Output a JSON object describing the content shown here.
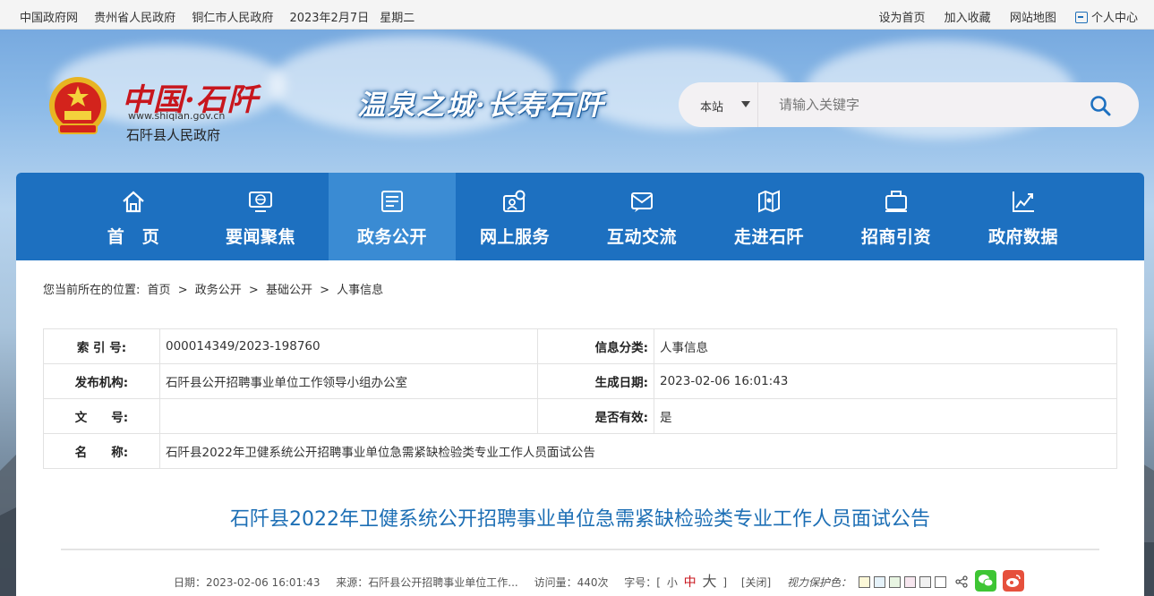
{
  "topbar": {
    "left": [
      "中国政府网",
      "贵州省人民政府",
      "铜仁市人民政府",
      "2023年2月7日",
      "星期二"
    ],
    "right": {
      "home": "设为首页",
      "favorite": "加入收藏",
      "sitemap": "网站地图",
      "personal": "个人中心"
    }
  },
  "header": {
    "logo_text": "中国·石阡",
    "logo_url": "www.shiqian.gov.cn",
    "org_name": "石阡县人民政府",
    "slogan": "温泉之城·长寿石阡"
  },
  "search": {
    "scope": "本站",
    "placeholder": "请输入关键字"
  },
  "nav": {
    "items": [
      {
        "label": "首　页",
        "icon": "home-icon"
      },
      {
        "label": "要闻聚焦",
        "icon": "globe-screen-icon"
      },
      {
        "label": "政务公开",
        "icon": "document-list-icon"
      },
      {
        "label": "网上服务",
        "icon": "service-person-icon"
      },
      {
        "label": "互动交流",
        "icon": "mail-icon"
      },
      {
        "label": "走进石阡",
        "icon": "map-icon"
      },
      {
        "label": "招商引资",
        "icon": "briefcase-icon"
      },
      {
        "label": "政府数据",
        "icon": "chart-icon"
      }
    ],
    "active_index": 2
  },
  "breadcrumb": {
    "prefix": "您当前所在的位置:",
    "items": [
      "首页",
      ">",
      "政务公开",
      ">",
      "基础公开",
      ">",
      "人事信息"
    ]
  },
  "meta": {
    "index_label": "索 引 号:",
    "index_value": "000014349/2023-198760",
    "category_label": "信息分类:",
    "category_value": "人事信息",
    "publisher_label": "发布机构:",
    "publisher_value": "石阡县公开招聘事业单位工作领导小组办公室",
    "date_label": "生成日期:",
    "date_value": "2023-02-06 16:01:43",
    "docno_label": "文　　号:",
    "docno_value": "",
    "valid_label": "是否有效:",
    "valid_value": "是",
    "name_label": "名　　称:",
    "name_value": "石阡县2022年卫健系统公开招聘事业单位急需紧缺检验类专业工作人员面试公告"
  },
  "article": {
    "title": "石阡县2022年卫健系统公开招聘事业单位急需紧缺检验类专业工作人员面试公告",
    "date": "日期：2023-02-06 16:01:43",
    "source": "来源：石阡县公开招聘事业单位工作...",
    "views": "访问量：440次",
    "font_label": "字号：[",
    "font_small": "小",
    "font_mid": "中",
    "font_large": "大",
    "font_end": "]",
    "close": "[关闭]",
    "eye_label": "视力保护色：",
    "eye_colors": [
      "#fcf8d8",
      "#e5f2fa",
      "#e8f5e2",
      "#f7e6ef",
      "#f1f1f1",
      "#ffffff"
    ]
  },
  "colors": {
    "nav": "#1d70c0",
    "nav_active": "#3a8bd3",
    "title": "#1d6fb5",
    "brand_red": "#c8161d"
  }
}
